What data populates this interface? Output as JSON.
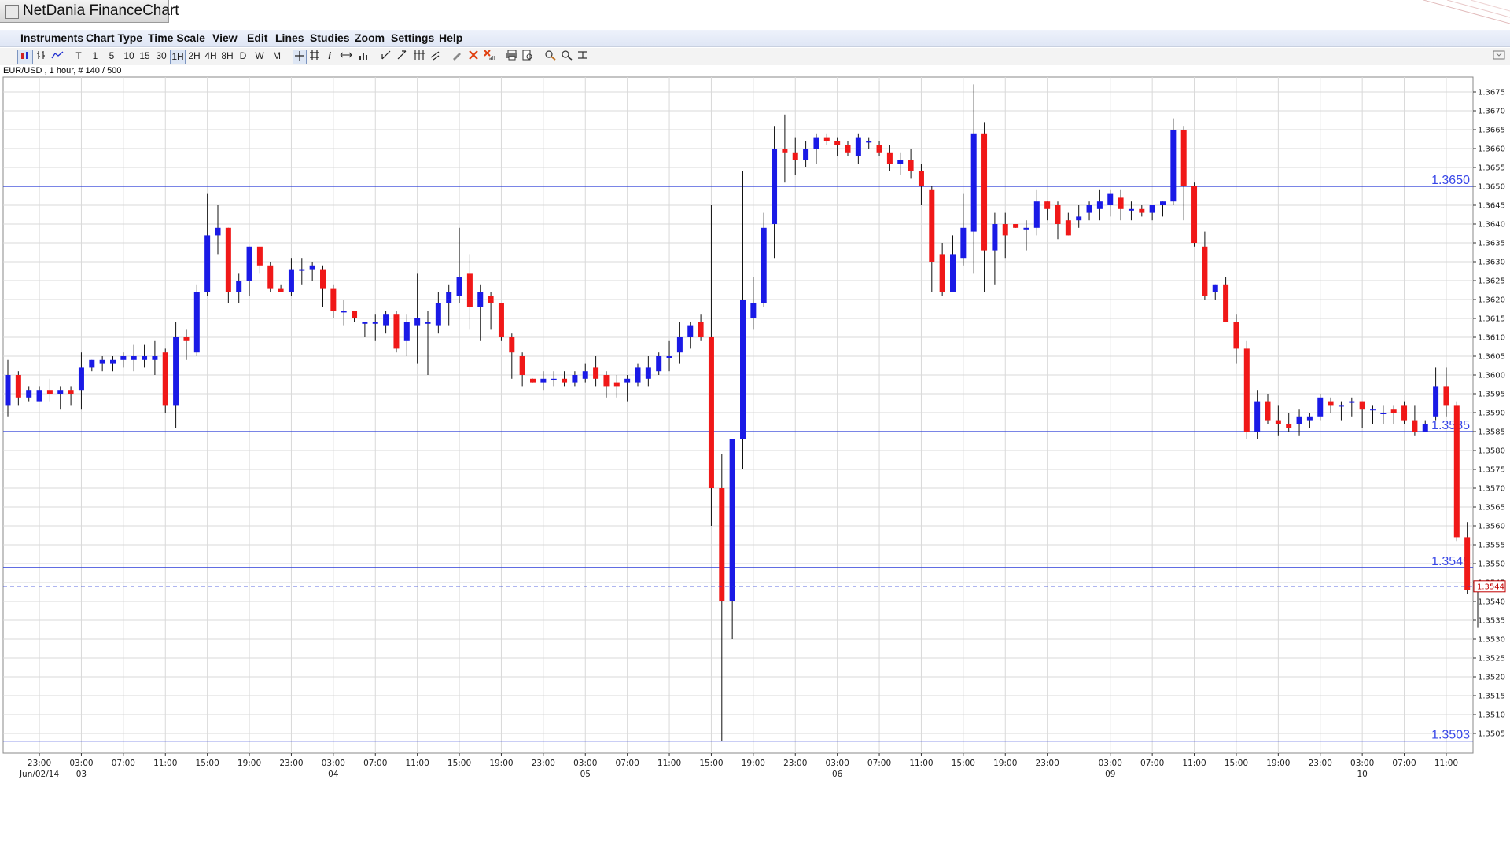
{
  "window": {
    "title": "NetDania FinanceChart"
  },
  "menu": [
    "Instruments",
    "Chart Type",
    "Time Scale",
    "View",
    "Edit",
    "Lines",
    "Studies",
    "Zoom",
    "Settings",
    "Help"
  ],
  "toolbar": {
    "timeframes": [
      "T",
      "1",
      "5",
      "10",
      "15",
      "30",
      "1H",
      "2H",
      "4H",
      "8H",
      "D",
      "W",
      "M"
    ],
    "selected_timeframe": "1H"
  },
  "chart_info": "EUR/USD , 1 hour, # 140 / 500",
  "colors": {
    "up": "#1a1ae6",
    "down": "#f01818",
    "grid": "#d9d9d9",
    "level_line": "#2b3cd8",
    "current_line": "#2b3cd8"
  },
  "chart_data": {
    "type": "candlestick",
    "instrument": "EUR/USD",
    "ylim": [
      1.35,
      1.368
    ],
    "y_ticks": [
      "1.3505",
      "1.3510",
      "1.3515",
      "1.3520",
      "1.3525",
      "1.3530",
      "1.3535",
      "1.3540",
      "1.3545",
      "1.3550",
      "1.3555",
      "1.3560",
      "1.3565",
      "1.3570",
      "1.3575",
      "1.3580",
      "1.3585",
      "1.3590",
      "1.3595",
      "1.3600",
      "1.3605",
      "1.3610",
      "1.3615",
      "1.3620",
      "1.3625",
      "1.3630",
      "1.3635",
      "1.3640",
      "1.3645",
      "1.3650",
      "1.3655",
      "1.3660",
      "1.3665",
      "1.3670",
      "1.3675"
    ],
    "x_ticks": [
      {
        "i": 3,
        "time": "23:00",
        "date": "Jun/02/14"
      },
      {
        "i": 7,
        "time": "03:00",
        "date": "03"
      },
      {
        "i": 11,
        "time": "07:00",
        "date": ""
      },
      {
        "i": 15,
        "time": "11:00",
        "date": ""
      },
      {
        "i": 19,
        "time": "15:00",
        "date": ""
      },
      {
        "i": 23,
        "time": "19:00",
        "date": ""
      },
      {
        "i": 27,
        "time": "23:00",
        "date": ""
      },
      {
        "i": 31,
        "time": "03:00",
        "date": "04"
      },
      {
        "i": 35,
        "time": "07:00",
        "date": ""
      },
      {
        "i": 39,
        "time": "11:00",
        "date": ""
      },
      {
        "i": 43,
        "time": "15:00",
        "date": ""
      },
      {
        "i": 47,
        "time": "19:00",
        "date": ""
      },
      {
        "i": 51,
        "time": "23:00",
        "date": ""
      },
      {
        "i": 55,
        "time": "03:00",
        "date": "05"
      },
      {
        "i": 59,
        "time": "07:00",
        "date": ""
      },
      {
        "i": 63,
        "time": "11:00",
        "date": ""
      },
      {
        "i": 67,
        "time": "15:00",
        "date": ""
      },
      {
        "i": 71,
        "time": "19:00",
        "date": ""
      },
      {
        "i": 75,
        "time": "23:00",
        "date": ""
      },
      {
        "i": 79,
        "time": "03:00",
        "date": "06"
      },
      {
        "i": 83,
        "time": "07:00",
        "date": ""
      },
      {
        "i": 87,
        "time": "11:00",
        "date": ""
      },
      {
        "i": 91,
        "time": "15:00",
        "date": ""
      },
      {
        "i": 95,
        "time": "19:00",
        "date": ""
      },
      {
        "i": 99,
        "time": "23:00",
        "date": ""
      },
      {
        "i": 105,
        "time": "03:00",
        "date": "09"
      },
      {
        "i": 109,
        "time": "07:00",
        "date": ""
      },
      {
        "i": 113,
        "time": "11:00",
        "date": ""
      },
      {
        "i": 117,
        "time": "15:00",
        "date": ""
      },
      {
        "i": 121,
        "time": "19:00",
        "date": ""
      },
      {
        "i": 125,
        "time": "23:00",
        "date": ""
      },
      {
        "i": 129,
        "time": "03:00",
        "date": "10"
      },
      {
        "i": 133,
        "time": "07:00",
        "date": ""
      },
      {
        "i": 137,
        "time": "11:00",
        "date": ""
      }
    ],
    "levels": [
      {
        "value": 1.365,
        "label": "1.3650"
      },
      {
        "value": 1.3585,
        "label": "1.3585"
      },
      {
        "value": 1.3549,
        "label": "1.3549"
      },
      {
        "value": 1.3503,
        "label": "1.3503"
      }
    ],
    "current_price": {
      "value": 1.3544,
      "label": "1.3544"
    },
    "candles": [
      {
        "o": 1.3592,
        "h": 1.3604,
        "l": 1.3589,
        "c": 1.36
      },
      {
        "o": 1.36,
        "h": 1.3601,
        "l": 1.3592,
        "c": 1.3594
      },
      {
        "o": 1.3594,
        "h": 1.3597,
        "l": 1.3593,
        "c": 1.3596
      },
      {
        "o": 1.3593,
        "h": 1.3597,
        "l": 1.3593,
        "c": 1.3596
      },
      {
        "o": 1.3596,
        "h": 1.3599,
        "l": 1.3593,
        "c": 1.3595
      },
      {
        "o": 1.3595,
        "h": 1.3597,
        "l": 1.3591,
        "c": 1.3596
      },
      {
        "o": 1.3596,
        "h": 1.3597,
        "l": 1.3592,
        "c": 1.3595
      },
      {
        "o": 1.3596,
        "h": 1.3606,
        "l": 1.3591,
        "c": 1.3602
      },
      {
        "o": 1.3602,
        "h": 1.3604,
        "l": 1.3601,
        "c": 1.3604
      },
      {
        "o": 1.3603,
        "h": 1.3605,
        "l": 1.3601,
        "c": 1.3604
      },
      {
        "o": 1.3603,
        "h": 1.3605,
        "l": 1.3601,
        "c": 1.3604
      },
      {
        "o": 1.3604,
        "h": 1.3606,
        "l": 1.3602,
        "c": 1.3605
      },
      {
        "o": 1.3604,
        "h": 1.3608,
        "l": 1.3601,
        "c": 1.3605
      },
      {
        "o": 1.3604,
        "h": 1.3608,
        "l": 1.3602,
        "c": 1.3605
      },
      {
        "o": 1.3604,
        "h": 1.3609,
        "l": 1.36,
        "c": 1.3605
      },
      {
        "o": 1.3606,
        "h": 1.3607,
        "l": 1.359,
        "c": 1.3592
      },
      {
        "o": 1.3592,
        "h": 1.3614,
        "l": 1.3586,
        "c": 1.361
      },
      {
        "o": 1.361,
        "h": 1.3612,
        "l": 1.3604,
        "c": 1.3609
      },
      {
        "o": 1.3606,
        "h": 1.3624,
        "l": 1.3605,
        "c": 1.3622
      },
      {
        "o": 1.3622,
        "h": 1.3648,
        "l": 1.3621,
        "c": 1.3637
      },
      {
        "o": 1.3637,
        "h": 1.3645,
        "l": 1.3632,
        "c": 1.3639
      },
      {
        "o": 1.3639,
        "h": 1.3639,
        "l": 1.3619,
        "c": 1.3622
      },
      {
        "o": 1.3622,
        "h": 1.3627,
        "l": 1.3619,
        "c": 1.3625
      },
      {
        "o": 1.3625,
        "h": 1.3634,
        "l": 1.3621,
        "c": 1.3634
      },
      {
        "o": 1.3634,
        "h": 1.3634,
        "l": 1.3627,
        "c": 1.3629
      },
      {
        "o": 1.3629,
        "h": 1.363,
        "l": 1.3622,
        "c": 1.3623
      },
      {
        "o": 1.3623,
        "h": 1.3624,
        "l": 1.3622,
        "c": 1.3622
      },
      {
        "o": 1.3622,
        "h": 1.3631,
        "l": 1.3621,
        "c": 1.3628
      },
      {
        "o": 1.3628,
        "h": 1.3631,
        "l": 1.3624,
        "c": 1.3628
      },
      {
        "o": 1.3628,
        "h": 1.363,
        "l": 1.3625,
        "c": 1.3629
      },
      {
        "o": 1.3628,
        "h": 1.3629,
        "l": 1.3618,
        "c": 1.3623
      },
      {
        "o": 1.3623,
        "h": 1.3624,
        "l": 1.3615,
        "c": 1.3617
      },
      {
        "o": 1.3617,
        "h": 1.362,
        "l": 1.3613,
        "c": 1.3617
      },
      {
        "o": 1.3617,
        "h": 1.3617,
        "l": 1.3614,
        "c": 1.3615
      },
      {
        "o": 1.3614,
        "h": 1.3614,
        "l": 1.361,
        "c": 1.3614
      },
      {
        "o": 1.3614,
        "h": 1.3616,
        "l": 1.3609,
        "c": 1.3614
      },
      {
        "o": 1.3613,
        "h": 1.3617,
        "l": 1.3611,
        "c": 1.3616
      },
      {
        "o": 1.3616,
        "h": 1.3617,
        "l": 1.3606,
        "c": 1.3607
      },
      {
        "o": 1.3609,
        "h": 1.3616,
        "l": 1.3605,
        "c": 1.3614
      },
      {
        "o": 1.3613,
        "h": 1.3627,
        "l": 1.3603,
        "c": 1.3615
      },
      {
        "o": 1.3614,
        "h": 1.3617,
        "l": 1.36,
        "c": 1.3614
      },
      {
        "o": 1.3613,
        "h": 1.3622,
        "l": 1.3611,
        "c": 1.3619
      },
      {
        "o": 1.3619,
        "h": 1.3624,
        "l": 1.3613,
        "c": 1.3622
      },
      {
        "o": 1.3621,
        "h": 1.3639,
        "l": 1.3619,
        "c": 1.3626
      },
      {
        "o": 1.3627,
        "h": 1.3632,
        "l": 1.3612,
        "c": 1.3618
      },
      {
        "o": 1.3618,
        "h": 1.3624,
        "l": 1.3609,
        "c": 1.3622
      },
      {
        "o": 1.3621,
        "h": 1.3622,
        "l": 1.3612,
        "c": 1.3619
      },
      {
        "o": 1.3619,
        "h": 1.3619,
        "l": 1.3609,
        "c": 1.361
      },
      {
        "o": 1.361,
        "h": 1.3611,
        "l": 1.3599,
        "c": 1.3606
      },
      {
        "o": 1.3605,
        "h": 1.3606,
        "l": 1.3597,
        "c": 1.36
      },
      {
        "o": 1.3599,
        "h": 1.3599,
        "l": 1.3598,
        "c": 1.3598
      },
      {
        "o": 1.3598,
        "h": 1.3601,
        "l": 1.3596,
        "c": 1.3599
      },
      {
        "o": 1.3599,
        "h": 1.3601,
        "l": 1.3597,
        "c": 1.3599
      },
      {
        "o": 1.3599,
        "h": 1.3601,
        "l": 1.3597,
        "c": 1.3598
      },
      {
        "o": 1.3598,
        "h": 1.3601,
        "l": 1.3597,
        "c": 1.36
      },
      {
        "o": 1.3599,
        "h": 1.3603,
        "l": 1.3598,
        "c": 1.3601
      },
      {
        "o": 1.3602,
        "h": 1.3605,
        "l": 1.3597,
        "c": 1.3599
      },
      {
        "o": 1.36,
        "h": 1.3601,
        "l": 1.3594,
        "c": 1.3597
      },
      {
        "o": 1.3598,
        "h": 1.36,
        "l": 1.3594,
        "c": 1.3597
      },
      {
        "o": 1.3598,
        "h": 1.36,
        "l": 1.3593,
        "c": 1.3599
      },
      {
        "o": 1.3598,
        "h": 1.3603,
        "l": 1.3597,
        "c": 1.3602
      },
      {
        "o": 1.3599,
        "h": 1.3605,
        "l": 1.3597,
        "c": 1.3602
      },
      {
        "o": 1.3601,
        "h": 1.3606,
        "l": 1.36,
        "c": 1.3605
      },
      {
        "o": 1.3605,
        "h": 1.3609,
        "l": 1.3601,
        "c": 1.3605
      },
      {
        "o": 1.3606,
        "h": 1.3614,
        "l": 1.3603,
        "c": 1.361
      },
      {
        "o": 1.361,
        "h": 1.3614,
        "l": 1.3607,
        "c": 1.3613
      },
      {
        "o": 1.3614,
        "h": 1.3616,
        "l": 1.3609,
        "c": 1.361
      },
      {
        "o": 1.361,
        "h": 1.3645,
        "l": 1.356,
        "c": 1.357
      },
      {
        "o": 1.357,
        "h": 1.3579,
        "l": 1.3503,
        "c": 1.354
      },
      {
        "o": 1.354,
        "h": 1.3583,
        "l": 1.353,
        "c": 1.3583
      },
      {
        "o": 1.3583,
        "h": 1.3654,
        "l": 1.3575,
        "c": 1.362
      },
      {
        "o": 1.3615,
        "h": 1.3626,
        "l": 1.3612,
        "c": 1.3619
      },
      {
        "o": 1.3619,
        "h": 1.3643,
        "l": 1.3618,
        "c": 1.3639
      },
      {
        "o": 1.364,
        "h": 1.3666,
        "l": 1.3631,
        "c": 1.366
      },
      {
        "o": 1.366,
        "h": 1.3669,
        "l": 1.3651,
        "c": 1.3659
      },
      {
        "o": 1.3659,
        "h": 1.3663,
        "l": 1.3653,
        "c": 1.3657
      },
      {
        "o": 1.3657,
        "h": 1.3662,
        "l": 1.3655,
        "c": 1.366
      },
      {
        "o": 1.366,
        "h": 1.3664,
        "l": 1.3656,
        "c": 1.3663
      },
      {
        "o": 1.3663,
        "h": 1.3664,
        "l": 1.3661,
        "c": 1.3662
      },
      {
        "o": 1.3662,
        "h": 1.3663,
        "l": 1.3658,
        "c": 1.3661
      },
      {
        "o": 1.3661,
        "h": 1.3662,
        "l": 1.3658,
        "c": 1.3659
      },
      {
        "o": 1.3658,
        "h": 1.3664,
        "l": 1.3656,
        "c": 1.3663
      },
      {
        "o": 1.3662,
        "h": 1.3663,
        "l": 1.366,
        "c": 1.3662
      },
      {
        "o": 1.3661,
        "h": 1.3662,
        "l": 1.3658,
        "c": 1.3659
      },
      {
        "o": 1.3659,
        "h": 1.3661,
        "l": 1.3654,
        "c": 1.3656
      },
      {
        "o": 1.3656,
        "h": 1.3659,
        "l": 1.3653,
        "c": 1.3657
      },
      {
        "o": 1.3657,
        "h": 1.366,
        "l": 1.3652,
        "c": 1.3654
      },
      {
        "o": 1.3654,
        "h": 1.3656,
        "l": 1.3645,
        "c": 1.365
      },
      {
        "o": 1.3649,
        "h": 1.365,
        "l": 1.3622,
        "c": 1.363
      },
      {
        "o": 1.3632,
        "h": 1.3635,
        "l": 1.3621,
        "c": 1.3622
      },
      {
        "o": 1.3622,
        "h": 1.3637,
        "l": 1.3622,
        "c": 1.3632
      },
      {
        "o": 1.3631,
        "h": 1.3648,
        "l": 1.3629,
        "c": 1.3639
      },
      {
        "o": 1.3638,
        "h": 1.3677,
        "l": 1.3627,
        "c": 1.3664
      },
      {
        "o": 1.3664,
        "h": 1.3667,
        "l": 1.3622,
        "c": 1.3633
      },
      {
        "o": 1.3633,
        "h": 1.3643,
        "l": 1.3624,
        "c": 1.364
      },
      {
        "o": 1.364,
        "h": 1.3643,
        "l": 1.3631,
        "c": 1.3637
      },
      {
        "o": 1.364,
        "h": 1.364,
        "l": 1.3639,
        "c": 1.3639
      },
      {
        "o": 1.3639,
        "h": 1.3641,
        "l": 1.3633,
        "c": 1.3639
      },
      {
        "o": 1.3639,
        "h": 1.3649,
        "l": 1.3637,
        "c": 1.3646
      },
      {
        "o": 1.3646,
        "h": 1.3646,
        "l": 1.3641,
        "c": 1.3644
      },
      {
        "o": 1.3645,
        "h": 1.3646,
        "l": 1.3636,
        "c": 1.364
      },
      {
        "o": 1.3641,
        "h": 1.3643,
        "l": 1.3637,
        "c": 1.3637
      },
      {
        "o": 1.3641,
        "h": 1.3645,
        "l": 1.3639,
        "c": 1.3642
      },
      {
        "o": 1.3643,
        "h": 1.3646,
        "l": 1.3641,
        "c": 1.3645
      },
      {
        "o": 1.3644,
        "h": 1.3649,
        "l": 1.3641,
        "c": 1.3646
      },
      {
        "o": 1.3645,
        "h": 1.3649,
        "l": 1.3642,
        "c": 1.3648
      },
      {
        "o": 1.3647,
        "h": 1.3649,
        "l": 1.3641,
        "c": 1.3644
      },
      {
        "o": 1.3644,
        "h": 1.3646,
        "l": 1.3641,
        "c": 1.3644
      },
      {
        "o": 1.3644,
        "h": 1.3645,
        "l": 1.3642,
        "c": 1.3643
      },
      {
        "o": 1.3643,
        "h": 1.3645,
        "l": 1.3641,
        "c": 1.3645
      },
      {
        "o": 1.3645,
        "h": 1.3646,
        "l": 1.3642,
        "c": 1.3646
      },
      {
        "o": 1.3646,
        "h": 1.3668,
        "l": 1.3645,
        "c": 1.3665
      },
      {
        "o": 1.3665,
        "h": 1.3666,
        "l": 1.3641,
        "c": 1.365
      },
      {
        "o": 1.365,
        "h": 1.3651,
        "l": 1.3634,
        "c": 1.3635
      },
      {
        "o": 1.3634,
        "h": 1.3638,
        "l": 1.362,
        "c": 1.3621
      },
      {
        "o": 1.3622,
        "h": 1.3624,
        "l": 1.362,
        "c": 1.3624
      },
      {
        "o": 1.3624,
        "h": 1.3626,
        "l": 1.3614,
        "c": 1.3614
      },
      {
        "o": 1.3614,
        "h": 1.3616,
        "l": 1.3603,
        "c": 1.3607
      },
      {
        "o": 1.3607,
        "h": 1.3609,
        "l": 1.3583,
        "c": 1.3585
      },
      {
        "o": 1.3585,
        "h": 1.3596,
        "l": 1.3583,
        "c": 1.3593
      },
      {
        "o": 1.3593,
        "h": 1.3595,
        "l": 1.3587,
        "c": 1.3588
      },
      {
        "o": 1.3588,
        "h": 1.3592,
        "l": 1.3584,
        "c": 1.3587
      },
      {
        "o": 1.3587,
        "h": 1.359,
        "l": 1.3585,
        "c": 1.3586
      },
      {
        "o": 1.3587,
        "h": 1.3591,
        "l": 1.3584,
        "c": 1.3589
      },
      {
        "o": 1.3588,
        "h": 1.359,
        "l": 1.3586,
        "c": 1.3589
      },
      {
        "o": 1.3589,
        "h": 1.3595,
        "l": 1.3588,
        "c": 1.3594
      },
      {
        "o": 1.3593,
        "h": 1.3594,
        "l": 1.359,
        "c": 1.3592
      },
      {
        "o": 1.3592,
        "h": 1.3593,
        "l": 1.3588,
        "c": 1.3592
      },
      {
        "o": 1.3593,
        "h": 1.3594,
        "l": 1.3589,
        "c": 1.3593
      },
      {
        "o": 1.3593,
        "h": 1.3593,
        "l": 1.3586,
        "c": 1.3591
      },
      {
        "o": 1.3591,
        "h": 1.3592,
        "l": 1.3587,
        "c": 1.3591
      },
      {
        "o": 1.359,
        "h": 1.3592,
        "l": 1.3587,
        "c": 1.359
      },
      {
        "o": 1.3591,
        "h": 1.3592,
        "l": 1.3587,
        "c": 1.359
      },
      {
        "o": 1.3592,
        "h": 1.3593,
        "l": 1.3587,
        "c": 1.3588
      },
      {
        "o": 1.3588,
        "h": 1.3592,
        "l": 1.3584,
        "c": 1.3585
      },
      {
        "o": 1.3585,
        "h": 1.3588,
        "l": 1.3585,
        "c": 1.3587
      },
      {
        "o": 1.3589,
        "h": 1.3602,
        "l": 1.3588,
        "c": 1.3597
      },
      {
        "o": 1.3597,
        "h": 1.3602,
        "l": 1.3589,
        "c": 1.3592
      },
      {
        "o": 1.3592,
        "h": 1.3593,
        "l": 1.3556,
        "c": 1.3557
      },
      {
        "o": 1.3557,
        "h": 1.3561,
        "l": 1.3542,
        "c": 1.3543
      },
      {
        "o": 1.3543,
        "h": 1.3545,
        "l": 1.3533,
        "c": 1.3544
      }
    ]
  }
}
